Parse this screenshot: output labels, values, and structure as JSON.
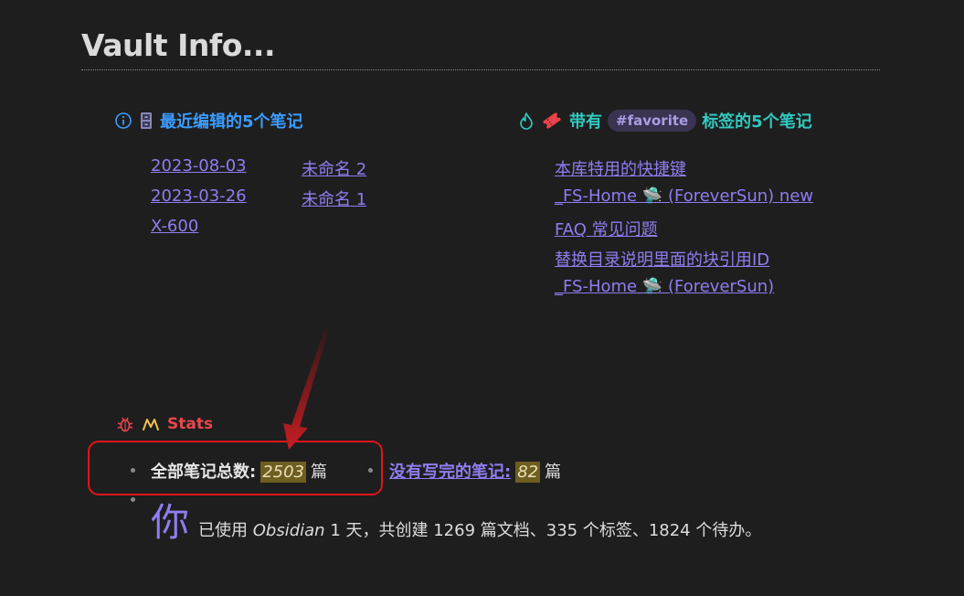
{
  "header": {
    "title": "Vault Info..."
  },
  "recent": {
    "title": "最近编辑的5个笔记",
    "items": [
      {
        "date": "2023-08-03",
        "name": "未命名 2"
      },
      {
        "date": "2023-03-26",
        "name": "未命名 1"
      },
      {
        "date": "X-600",
        "name": ""
      }
    ]
  },
  "favorites": {
    "prefix": "带有",
    "tag": "#favorite",
    "suffix": "标签的5个笔记",
    "items": [
      "本库特用的快捷键",
      "_FS-Home 🛸 (ForeverSun) new",
      "FAQ 常见问题",
      "替换目录说明里面的块引用ID",
      "_FS-Home 🛸 (ForeverSun)"
    ]
  },
  "stats": {
    "title": "Stats",
    "total_label": "全部笔记总数:",
    "total_value": "2503",
    "total_unit": "篇",
    "unfinished_label": "没有写完的笔记:",
    "unfinished_value": "82",
    "unfinished_unit": "篇",
    "usage_big": "你",
    "usage_1": "已使用 ",
    "usage_app": "Obsidian",
    "usage_2": " 1 天，共创建 1269 篇文档、335 个标签、1824 个待办。"
  },
  "colors": {
    "background": "#1e1e1e",
    "link": "#8f7df0",
    "info_heading": "#3b9cff",
    "favorite_heading": "#30c9c0",
    "stats_heading": "#e9464e",
    "annotation_red": "#e0141b"
  },
  "icons": {
    "recent": [
      "info-icon",
      "file-cabinet-icon"
    ],
    "favorites": [
      "flame-icon",
      "ticket-icon"
    ],
    "stats": [
      "bug-icon",
      "activity-icon"
    ]
  }
}
